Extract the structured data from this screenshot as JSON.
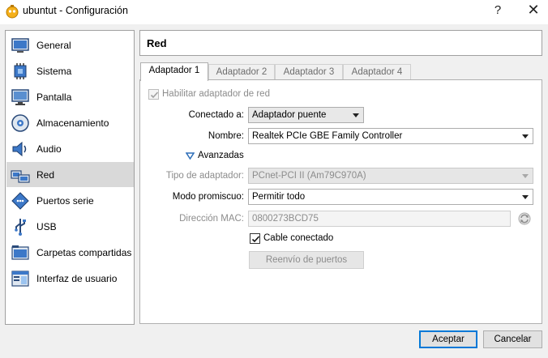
{
  "window": {
    "title": "ubuntut - Configuración",
    "help_label": "?",
    "close_label": "✕"
  },
  "sidebar": {
    "items": [
      {
        "label": "General",
        "icon": "general-icon"
      },
      {
        "label": "Sistema",
        "icon": "system-chip-icon"
      },
      {
        "label": "Pantalla",
        "icon": "display-monitor-icon"
      },
      {
        "label": "Almacenamiento",
        "icon": "storage-disk-icon"
      },
      {
        "label": "Audio",
        "icon": "speaker-icon"
      },
      {
        "label": "Red",
        "icon": "network-icon",
        "selected": true
      },
      {
        "label": "Puertos serie",
        "icon": "serial-port-icon"
      },
      {
        "label": "USB",
        "icon": "usb-icon"
      },
      {
        "label": "Carpetas compartidas",
        "icon": "shared-folder-icon"
      },
      {
        "label": "Interfaz de usuario",
        "icon": "user-interface-icon"
      }
    ]
  },
  "section": {
    "title": "Red"
  },
  "tabs": [
    {
      "label": "Adaptador 1",
      "active": true
    },
    {
      "label": "Adaptador 2"
    },
    {
      "label": "Adaptador 3"
    },
    {
      "label": "Adaptador 4"
    }
  ],
  "form": {
    "enable_adapter_label": "Habilitar adaptador de red",
    "enable_adapter_checked": true,
    "attached_to_label": "Conectado a:",
    "attached_to_value": "Adaptador puente",
    "name_label": "Nombre:",
    "name_value": "Realtek PCIe GBE Family Controller",
    "advanced_label": "Avanzadas",
    "adapter_type_label": "Tipo de adaptador:",
    "adapter_type_value": "PCnet-PCI II (Am79C970A)",
    "promiscuous_label": "Modo promiscuo:",
    "promiscuous_value": "Permitir todo",
    "mac_label": "Dirección MAC:",
    "mac_value": "0800273BCD75",
    "cable_label": "Cable conectado",
    "cable_checked": true,
    "port_forwarding_label": "Reenvío de puertos"
  },
  "footer": {
    "accept_label": "Aceptar",
    "cancel_label": "Cancelar"
  },
  "colors": {
    "accent": "#0078d7",
    "selected_row": "#d9d9d9",
    "disabled_text": "#8c8c8c",
    "window_bg": "#f0f0f0"
  }
}
